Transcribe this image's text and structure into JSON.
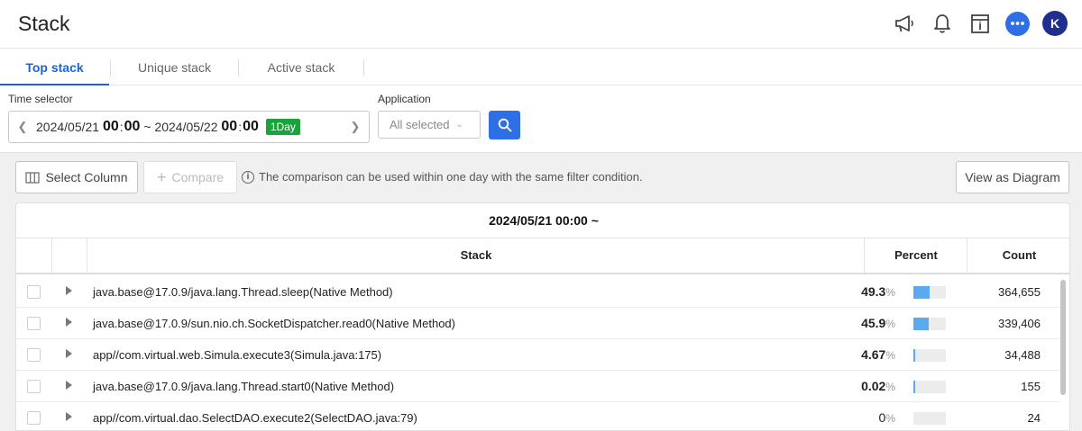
{
  "header": {
    "title": "Stack",
    "icons": [
      "megaphone-icon",
      "bell-icon",
      "info-panel-icon",
      "chat-icon"
    ],
    "avatar_initial": "K",
    "accent_color": "#2f6fe6"
  },
  "tabs": [
    {
      "label": "Top stack",
      "active": true
    },
    {
      "label": "Unique stack",
      "active": false
    },
    {
      "label": "Active stack",
      "active": false
    }
  ],
  "filters": {
    "time_selector_label": "Time selector",
    "time_start_date": "2024/05/21",
    "time_start_hh": "00",
    "time_start_mm": "00",
    "time_sep": "~",
    "time_end_date": "2024/05/22",
    "time_end_hh": "00",
    "time_end_mm": "00",
    "range_badge": "1Day",
    "application_label": "Application",
    "application_value": "All selected"
  },
  "toolbar": {
    "select_column_label": "Select Column",
    "compare_label": "Compare",
    "info_text": "The comparison can be used within one day with the same filter condition.",
    "view_diagram_label": "View as Diagram"
  },
  "table": {
    "title": "2024/05/21 00:00 ~",
    "columns": {
      "stack": "Stack",
      "percent": "Percent",
      "count": "Count"
    },
    "percent_unit": "%",
    "rows": [
      {
        "stack": "java.base@17.0.9/java.lang.Thread.sleep(Native Method)",
        "percent": "49.3",
        "percent_value": 49.3,
        "count": "364,655"
      },
      {
        "stack": "java.base@17.0.9/sun.nio.ch.SocketDispatcher.read0(Native Method)",
        "percent": "45.9",
        "percent_value": 45.9,
        "count": "339,406"
      },
      {
        "stack": "app//com.virtual.web.Simula.execute3(Simula.java:175)",
        "percent": "4.67",
        "percent_value": 4.67,
        "count": "34,488"
      },
      {
        "stack": "java.base@17.0.9/java.lang.Thread.start0(Native Method)",
        "percent": "0.02",
        "percent_value": 0.02,
        "count": "155"
      },
      {
        "stack": "app//com.virtual.dao.SelectDAO.execute2(SelectDAO.java:79)",
        "percent": "0",
        "percent_value": 0,
        "count": "24"
      }
    ]
  }
}
